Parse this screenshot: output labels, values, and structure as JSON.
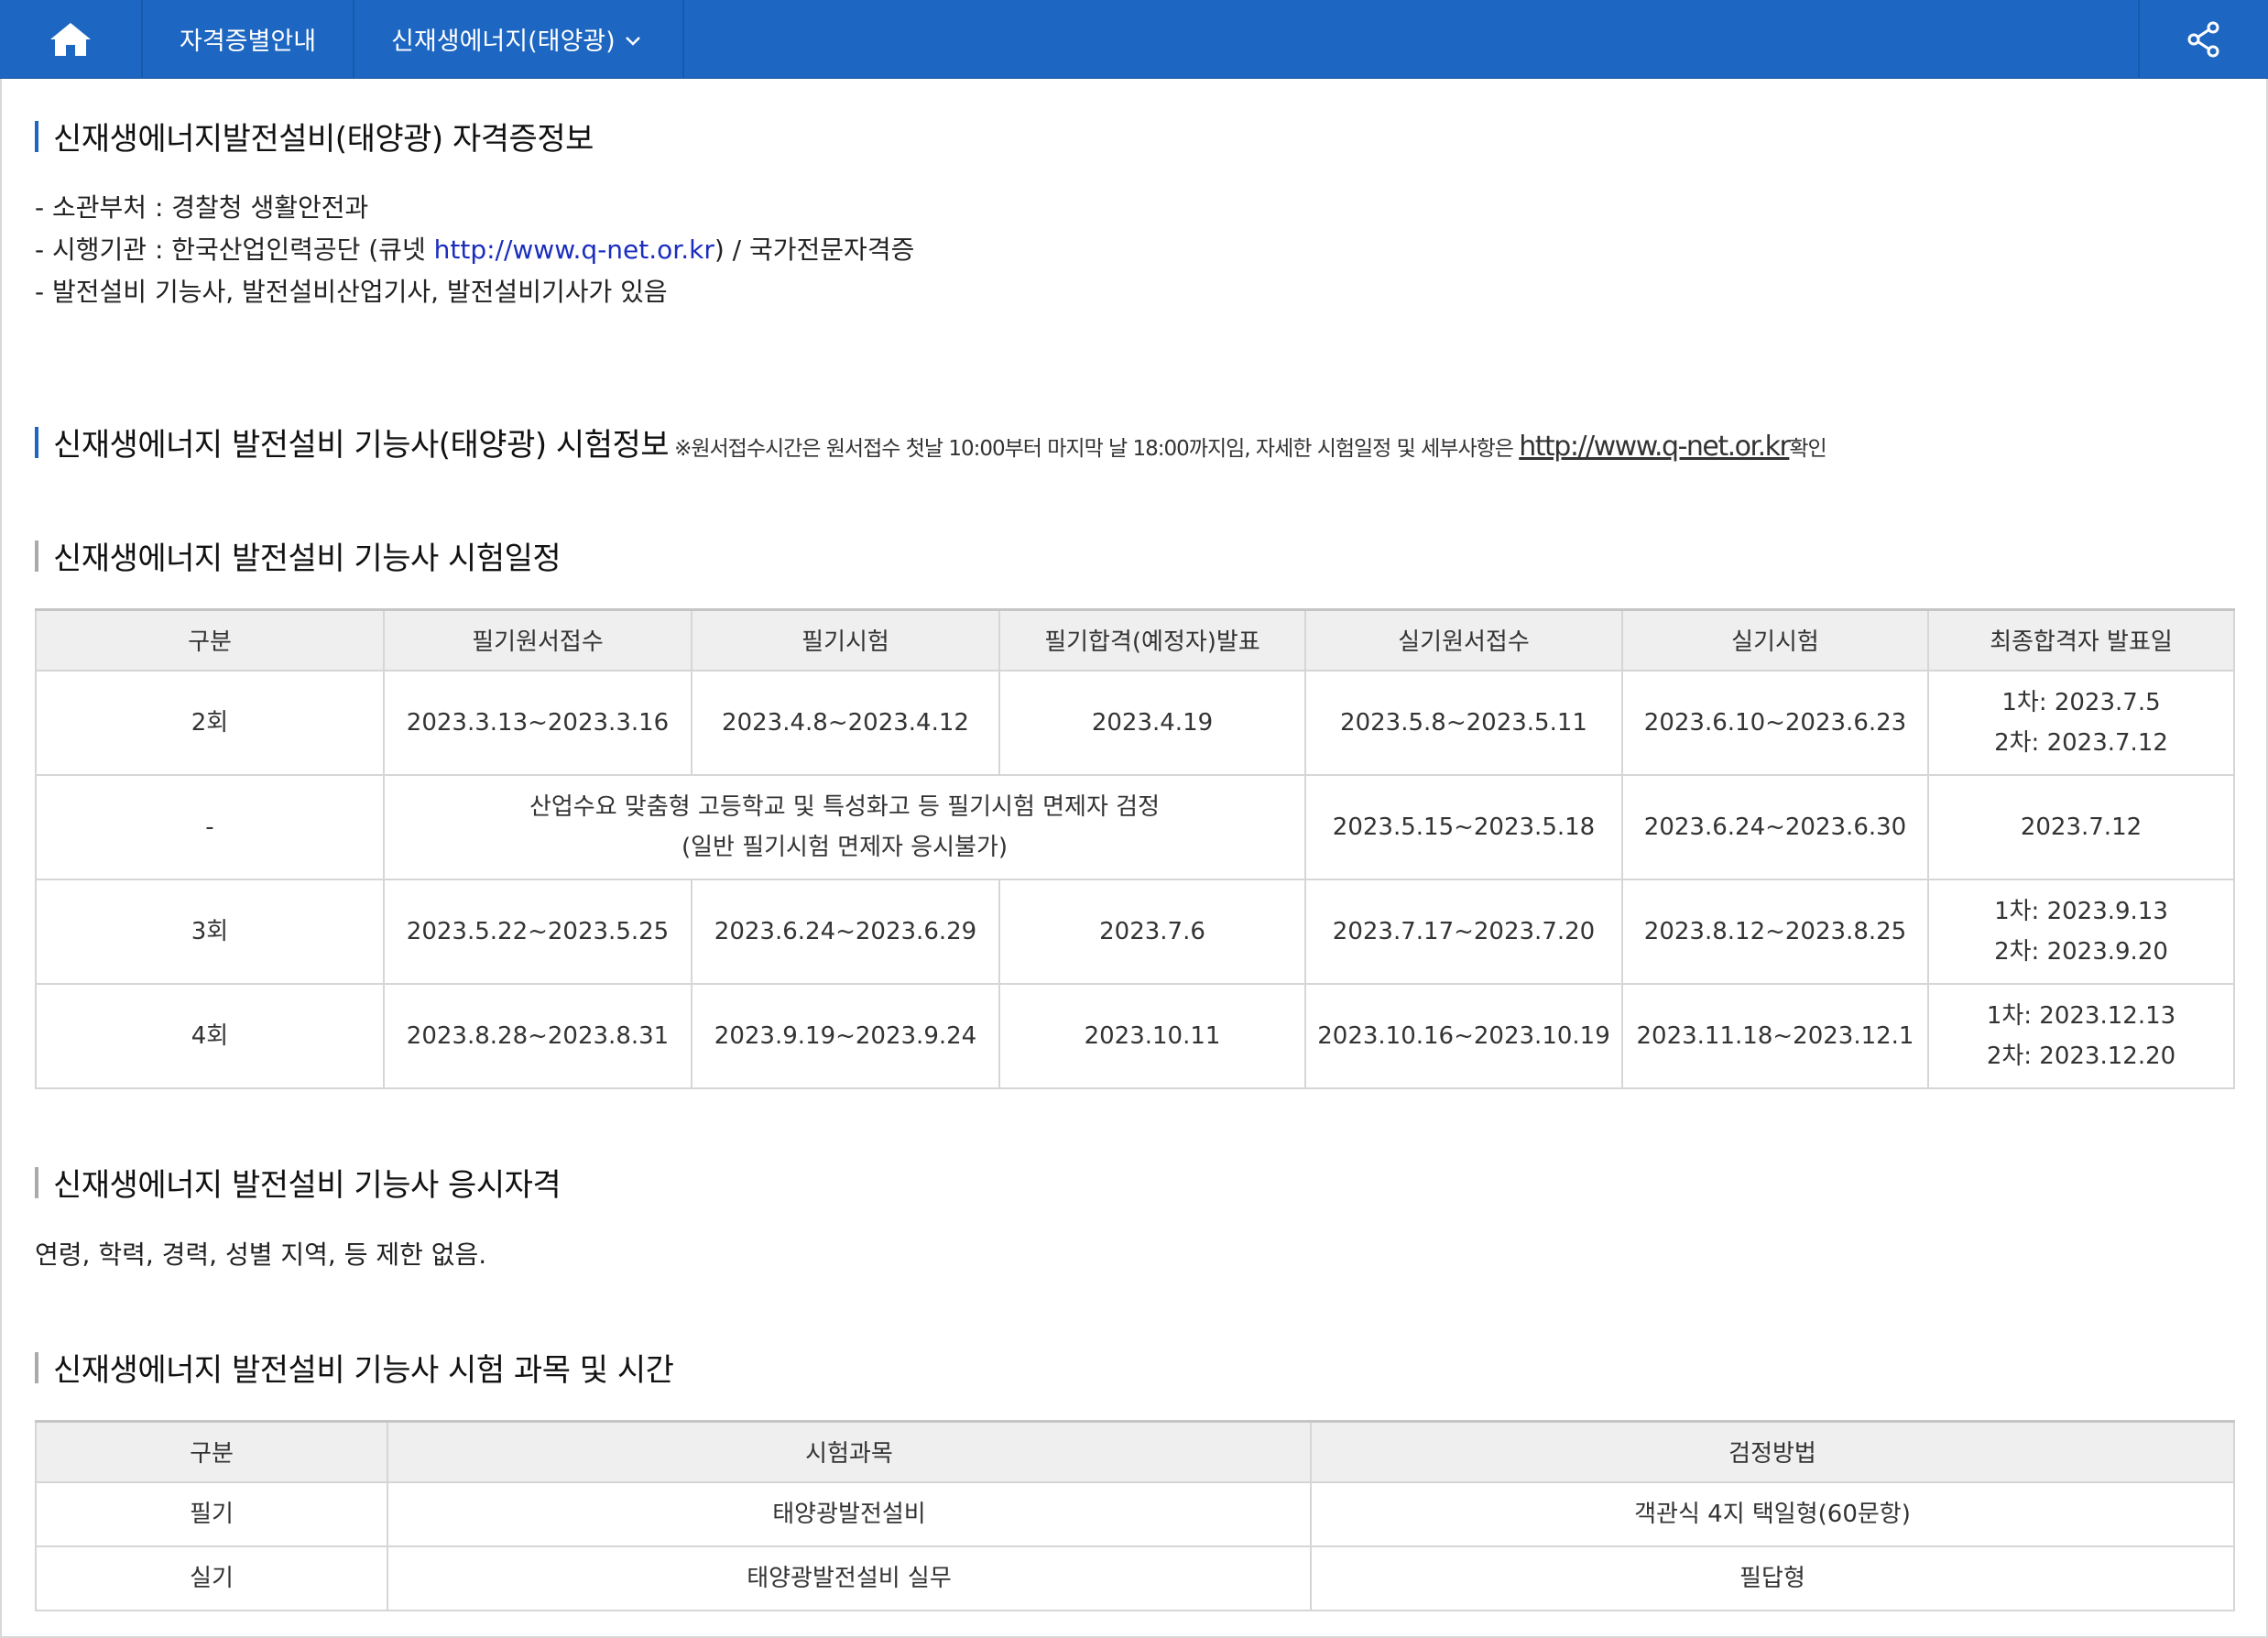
{
  "nav": {
    "item1": "자격증별안내",
    "item2": "신재생에너지(태양광)"
  },
  "section1": {
    "title": "신재생에너지발전설비(태양광) 자격증정보",
    "line1": "- 소관부처 : 경찰청 생활안전과",
    "line2_prefix": "- 시행기관 : 한국산업인력공단 (큐넷 ",
    "line2_link": "http://www.q-net.or.kr",
    "line2_suffix": ") / 국가전문자격증",
    "line3": "- 발전설비 기능사, 발전설비산업기사, 발전설비기사가 있음"
  },
  "section2": {
    "title": "신재생에너지 발전설비 기능사(태양광) 시험정보",
    "note": "※원서접수시간은 원서접수 첫날 10:00부터 마지막 날 18:00까지임, 자세한 시험일정 및 세부사항은 ",
    "note_link": "http://www.q-net.or.kr",
    "note_suffix": "확인"
  },
  "schedule": {
    "title": "신재생에너지 발전설비 기능사 시험일정",
    "headers": [
      "구분",
      "필기원서접수",
      "필기시험",
      "필기합격(예정자)발표",
      "실기원서접수",
      "실기시험",
      "최종합격자 발표일"
    ],
    "rows": [
      {
        "cells": [
          "2회",
          "2023.3.13~2023.3.16",
          "2023.4.8~2023.4.12",
          "2023.4.19",
          "2023.5.8~2023.5.11",
          "2023.6.10~2023.6.23"
        ],
        "final1": "1차: 2023.7.5",
        "final2": "2차: 2023.7.12"
      },
      {
        "cells": [
          "-",
          "",
          "",
          "",
          "2023.5.15~2023.5.18",
          "2023.6.24~2023.6.30"
        ],
        "merged1": "산업수요 맞춤형 고등학교 및 특성화고 등 필기시험 면제자 검정",
        "merged2": "(일반 필기시험 면제자 응시불가)",
        "final1": "2023.7.12"
      },
      {
        "cells": [
          "3회",
          "2023.5.22~2023.5.25",
          "2023.6.24~2023.6.29",
          "2023.7.6",
          "2023.7.17~2023.7.20",
          "2023.8.12~2023.8.25"
        ],
        "final1": "1차: 2023.9.13",
        "final2": "2차: 2023.9.20"
      },
      {
        "cells": [
          "4회",
          "2023.8.28~2023.8.31",
          "2023.9.19~2023.9.24",
          "2023.10.11",
          "2023.10.16~2023.10.19",
          "2023.11.18~2023.12.1"
        ],
        "final1": "1차: 2023.12.13",
        "final2": "2차: 2023.12.20"
      }
    ]
  },
  "eligibility": {
    "title": "신재생에너지 발전설비 기능사 응시자격",
    "text": "연령, 학력, 경력, 성별 지역, 등 제한 없음."
  },
  "subjects": {
    "title": "신재생에너지 발전설비 기능사 시험 과목 및 시간",
    "headers": [
      "구분",
      "시험과목",
      "검정방법"
    ],
    "rows": [
      [
        "필기",
        "태양광발전설비",
        "객관식 4지 택일형(60문항)"
      ],
      [
        "실기",
        "태양광발전설비 실무",
        "필답형"
      ]
    ]
  },
  "colors": {
    "nav_bg": "#1d66c2",
    "link": "#1a2dbd",
    "header_bg": "#efefef"
  },
  "icons": [
    "home-icon",
    "chevron-down-icon",
    "share-icon"
  ]
}
